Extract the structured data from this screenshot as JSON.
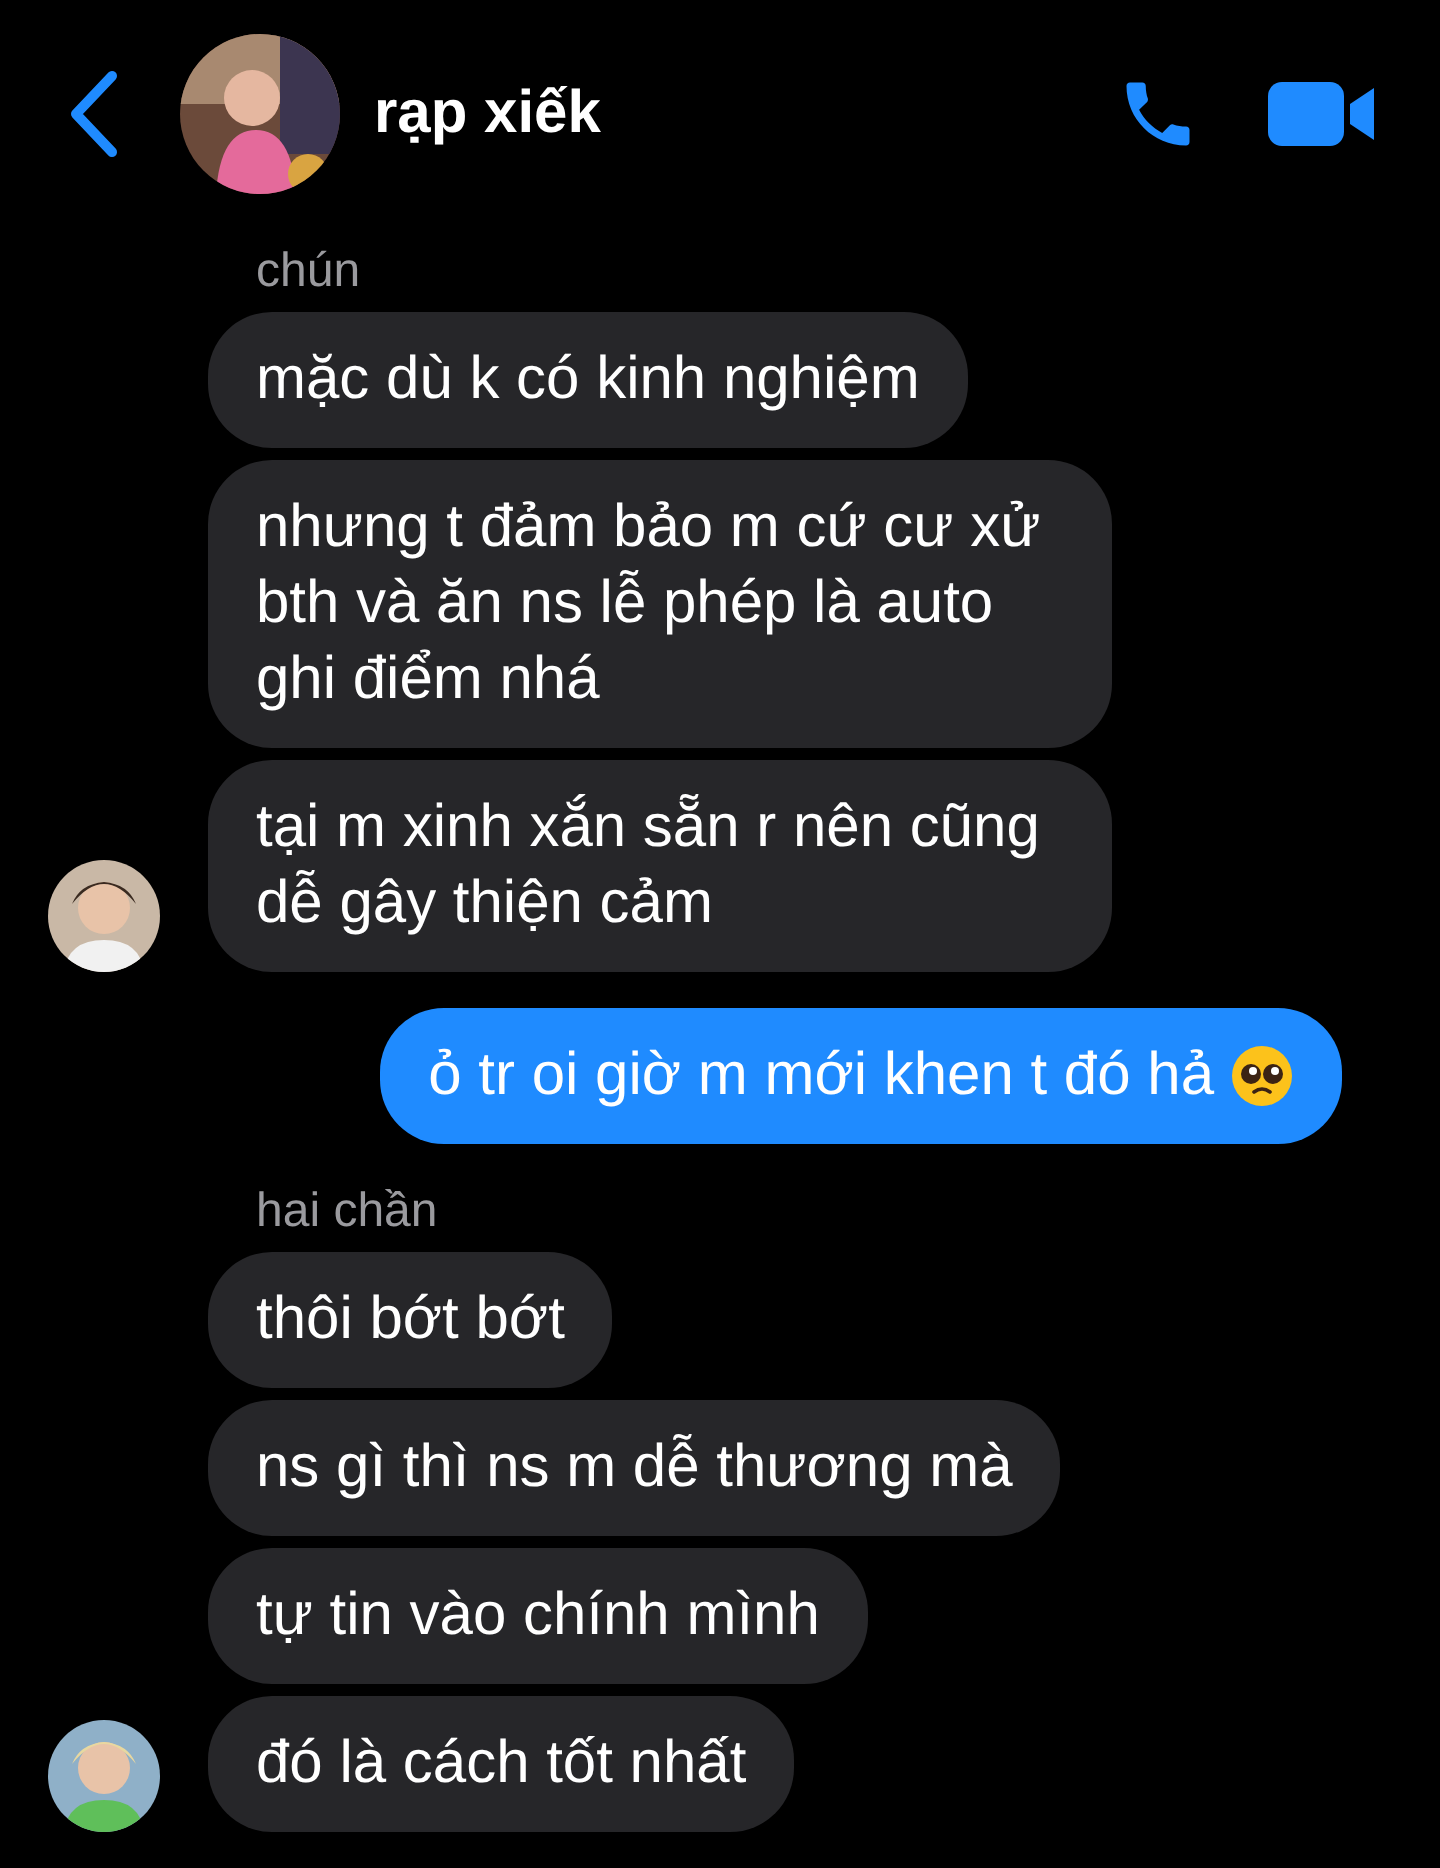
{
  "header": {
    "title": "rạp xiếk"
  },
  "groups": [
    {
      "outgoing": false,
      "sender": "chún",
      "messages": [
        {
          "kind": "text",
          "text": "mặc dù k có kinh nghiệm"
        },
        {
          "kind": "text",
          "text": "nhưng t đảm bảo m cứ cư xử bth và ăn ns lễ phép là auto ghi điểm nhá"
        },
        {
          "kind": "text",
          "text": "tại m xinh xắn sẵn r nên cũng dễ gây thiện cảm"
        }
      ]
    },
    {
      "outgoing": true,
      "messages": [
        {
          "kind": "emoji",
          "text": "ỏ tr oi giờ m mới khen t đó hả"
        }
      ]
    },
    {
      "outgoing": false,
      "sender": "hai chần",
      "messages": [
        {
          "kind": "text",
          "text": "thôi bớt bớt"
        },
        {
          "kind": "text",
          "text": "ns gì thì ns m dễ thương mà"
        },
        {
          "kind": "text",
          "text": "tự tin vào chính mình"
        },
        {
          "kind": "text",
          "text": "đó là cách tốt nhất"
        }
      ]
    }
  ]
}
